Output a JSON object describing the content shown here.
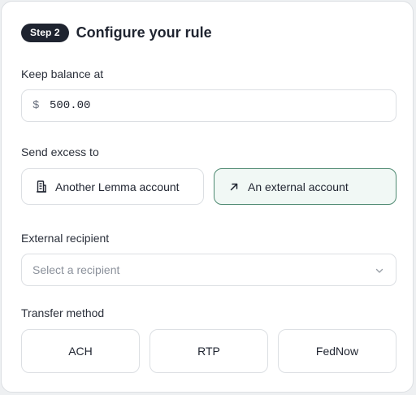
{
  "header": {
    "step_badge": "Step 2",
    "title": "Configure your rule"
  },
  "balance": {
    "label": "Keep balance at",
    "currency_symbol": "$",
    "value": "500.00"
  },
  "send_excess": {
    "label": "Send excess to",
    "options": [
      {
        "label": "Another Lemma account",
        "icon": "building-icon",
        "selected": false
      },
      {
        "label": "An external account",
        "icon": "arrow-up-right-icon",
        "selected": true
      }
    ]
  },
  "recipient": {
    "label": "External recipient",
    "placeholder": "Select a recipient"
  },
  "transfer_method": {
    "label": "Transfer method",
    "options": [
      "ACH",
      "RTP",
      "FedNow"
    ]
  },
  "colors": {
    "badge_bg": "#1f2430",
    "selected_border": "#4f8a72",
    "selected_bg": "#f1f8f5",
    "border": "#dcdfe3"
  }
}
